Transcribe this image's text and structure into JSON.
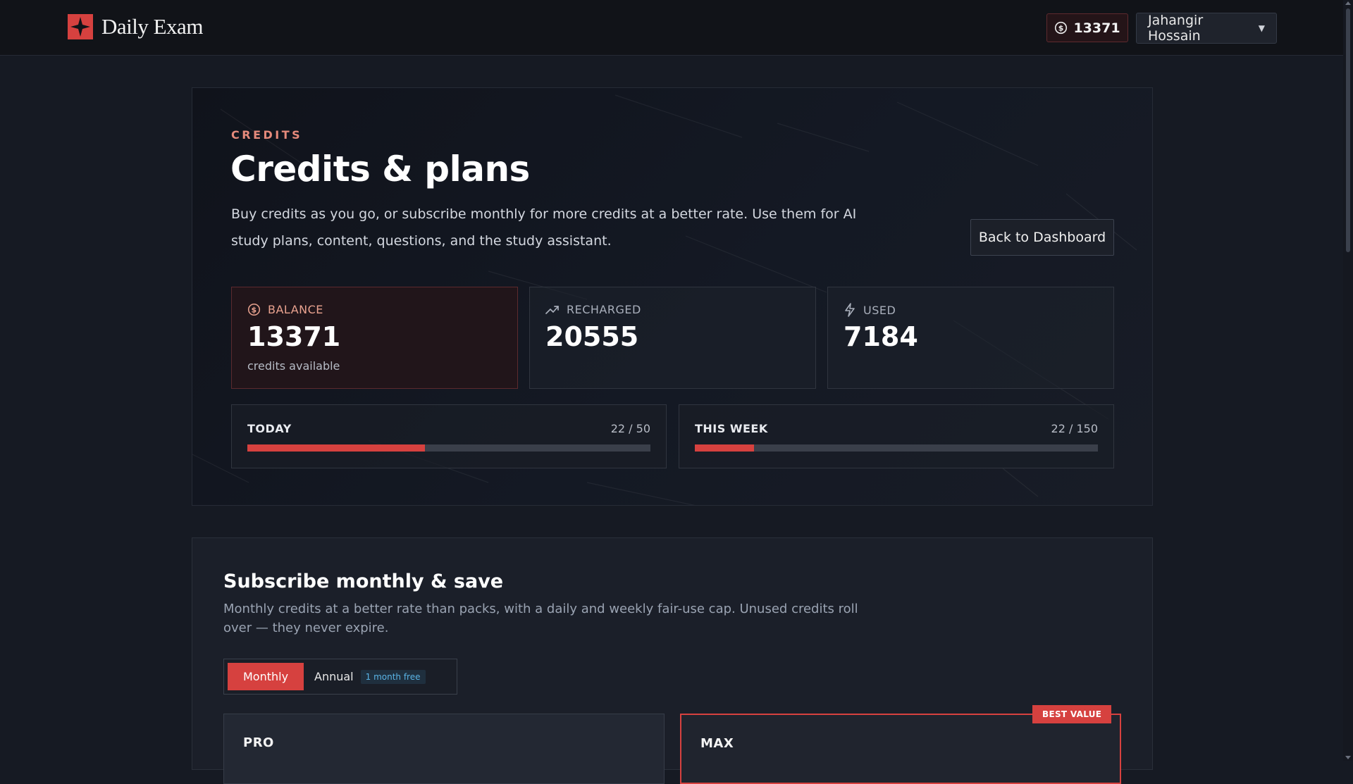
{
  "header": {
    "brand": "Daily Exam",
    "credits": "13371",
    "user_name": "Jahangir Hossain"
  },
  "hero": {
    "eyebrow": "CREDITS",
    "title": "Credits & plans",
    "description": "Buy credits as you go, or subscribe monthly for more credits at a better rate. Use them for AI study plans, content, questions, and the study assistant.",
    "back_button": "Back to Dashboard"
  },
  "stats": {
    "balance": {
      "label": "BALANCE",
      "value": "13371",
      "sub": "credits available"
    },
    "recharged": {
      "label": "RECHARGED",
      "value": "20555"
    },
    "used": {
      "label": "USED",
      "value": "7184"
    }
  },
  "usage": {
    "today": {
      "label": "TODAY",
      "count": "22 / 50",
      "used": 22,
      "limit": 50
    },
    "week": {
      "label": "THIS WEEK",
      "count": "22 / 150",
      "used": 22,
      "limit": 150
    }
  },
  "subscribe": {
    "title": "Subscribe monthly & save",
    "description": "Monthly credits at a better rate than packs, with a daily and weekly fair-use cap. Unused credits roll over — they never expire.",
    "toggle_monthly": "Monthly",
    "toggle_annual": "Annual",
    "annual_badge": "1 month free",
    "plans": [
      {
        "name": "PRO"
      },
      {
        "name": "MAX",
        "badge": "BEST VALUE"
      }
    ]
  },
  "colors": {
    "accent": "#d6413f",
    "background": "#161a23",
    "navbar": "#111318",
    "eyebrow": "#e58a7b",
    "info": "#5ab4e6"
  },
  "icons": {
    "credit_pill": "dollar-coin-icon",
    "balance": "dollar-coin-icon",
    "recharged": "trending-up-icon",
    "used": "lightning-icon",
    "user_menu": "chevron-down-icon"
  }
}
